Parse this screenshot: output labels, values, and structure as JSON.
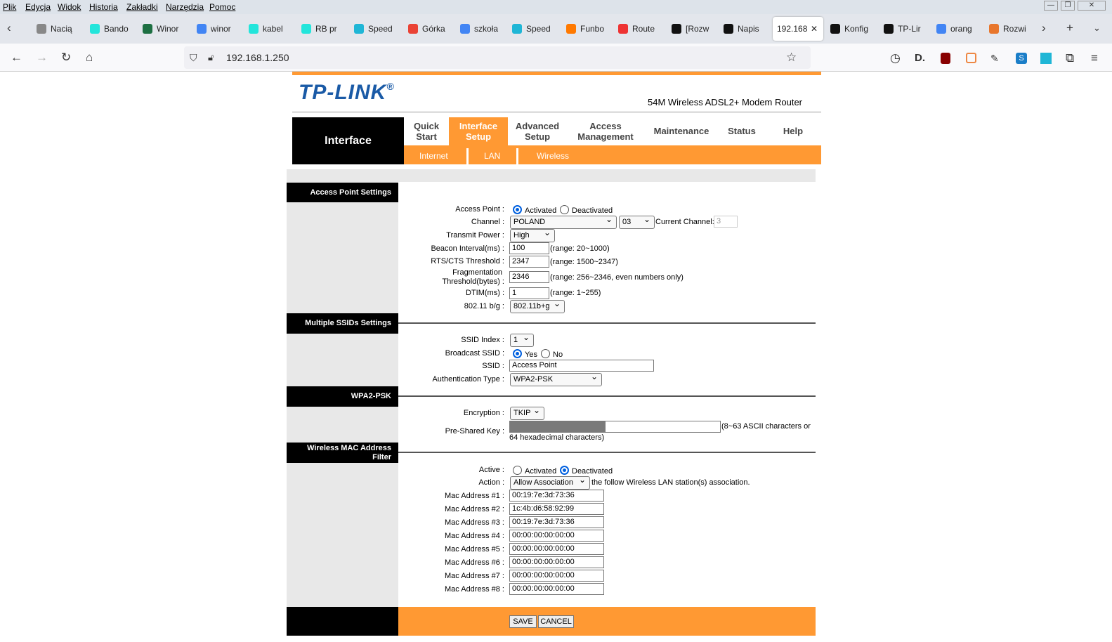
{
  "menu": {
    "items": [
      "Plik",
      "Edycja",
      "Widok",
      "Historia",
      "Zakładki",
      "Narzędzia",
      "Pomoc"
    ]
  },
  "tabs": [
    {
      "label": "Nacią",
      "icon": "ct-icon"
    },
    {
      "label": "Bando",
      "icon": "olx-icon"
    },
    {
      "label": "Winor",
      "icon": "spreadsheet-icon"
    },
    {
      "label": "winor",
      "icon": "google-icon"
    },
    {
      "label": "kabel",
      "icon": "olx-icon"
    },
    {
      "label": "RB pr",
      "icon": "olx-icon"
    },
    {
      "label": "Speed",
      "icon": "speedtest-icon"
    },
    {
      "label": "Górka",
      "icon": "map-pin-icon"
    },
    {
      "label": "szkoła",
      "icon": "google-icon"
    },
    {
      "label": "Speed",
      "icon": "speedtest-icon"
    },
    {
      "label": "Funbo",
      "icon": "orange-icon"
    },
    {
      "label": "Route",
      "icon": "router-icon"
    },
    {
      "label": "[Rozw",
      "icon": "edge-icon"
    },
    {
      "label": "Napis",
      "icon": "edge-icon"
    },
    {
      "label": "192.168",
      "icon": ""
    },
    {
      "label": "Konfig",
      "icon": "edge-icon"
    },
    {
      "label": "TP-Lir",
      "icon": "edge-icon"
    },
    {
      "label": "orang",
      "icon": "google-icon"
    },
    {
      "label": "Rozwi",
      "icon": "forum-icon"
    }
  ],
  "url": "192.168.1.250",
  "router": {
    "brand": "TP-LINK",
    "registered": "®",
    "model": "54M Wireless ADSL2+ Modem Router",
    "section_title": "Interface",
    "nav": [
      {
        "label1": "Quick",
        "label2": "Start"
      },
      {
        "label1": "Interface",
        "label2": "Setup"
      },
      {
        "label1": "Advanced",
        "label2": "Setup"
      },
      {
        "label1": "Access",
        "label2": "Management"
      },
      {
        "label1": "Maintenance",
        "label2": ""
      },
      {
        "label1": "Status",
        "label2": ""
      },
      {
        "label1": "Help",
        "label2": ""
      }
    ],
    "subnav": [
      "Internet",
      "LAN",
      "Wireless"
    ]
  },
  "ap": {
    "section": "Access Point Settings",
    "access_point_label": "Access Point :",
    "activated": "Activated",
    "deactivated": "Deactivated",
    "channel_label": "Channel :",
    "channel_country": "POLAND",
    "channel_num": "03",
    "current_channel_label": "Current Channel:",
    "current_channel": "3",
    "tx_label": "Transmit Power :",
    "tx_value": "High",
    "beacon_label": "Beacon Interval(ms) :",
    "beacon_value": "100",
    "beacon_range": "(range: 20~1000)",
    "rts_label": "RTS/CTS Threshold :",
    "rts_value": "2347",
    "rts_range": "(range: 1500~2347)",
    "frag_label1": "Fragmentation",
    "frag_label2": "Threshold(bytes) :",
    "frag_value": "2346",
    "frag_range": "(range: 256~2346, even numbers only)",
    "dtim_label": "DTIM(ms) :",
    "dtim_value": "1",
    "dtim_range": "(range: 1~255)",
    "mode_label": "802.11 b/g :",
    "mode_value": "802.11b+g"
  },
  "ssid": {
    "section": "Multiple SSIDs Settings",
    "index_label": "SSID Index :",
    "index_value": "1",
    "broadcast_label": "Broadcast SSID :",
    "yes": "Yes",
    "no": "No",
    "ssid_label": "SSID :",
    "ssid_value": "Access Point",
    "auth_label": "Authentication Type :",
    "auth_value": "WPA2-PSK"
  },
  "wpa": {
    "section": "WPA2-PSK",
    "enc_label": "Encryption :",
    "enc_value": "TKIP",
    "psk_label": "Pre-Shared Key :",
    "psk_hint1": "(8~63 ASCII characters or",
    "psk_hint2": "64 hexadecimal characters)"
  },
  "mac": {
    "section1": "Wireless MAC Address",
    "section2": "Filter",
    "active_label": "Active :",
    "activated": "Activated",
    "deactivated": "Deactivated",
    "action_label": "Action :",
    "action_value": "Allow Association",
    "action_text": "the follow Wireless LAN station(s) association.",
    "addresses": [
      {
        "label": "Mac Address #1 :",
        "value": "00:19:7e:3d:73:36"
      },
      {
        "label": "Mac Address #2 :",
        "value": "1c:4b:d6:58:92:99"
      },
      {
        "label": "Mac Address #3 :",
        "value": "00:19:7e:3d:73:36"
      },
      {
        "label": "Mac Address #4 :",
        "value": "00:00:00:00:00:00"
      },
      {
        "label": "Mac Address #5 :",
        "value": "00:00:00:00:00:00"
      },
      {
        "label": "Mac Address #6 :",
        "value": "00:00:00:00:00:00"
      },
      {
        "label": "Mac Address #7 :",
        "value": "00:00:00:00:00:00"
      },
      {
        "label": "Mac Address #8 :",
        "value": "00:00:00:00:00:00"
      }
    ]
  },
  "buttons": {
    "save": "SAVE",
    "cancel": "CANCEL"
  },
  "colors": {
    "orange": "#ff9933",
    "brand_blue": "#1a5aa6"
  }
}
